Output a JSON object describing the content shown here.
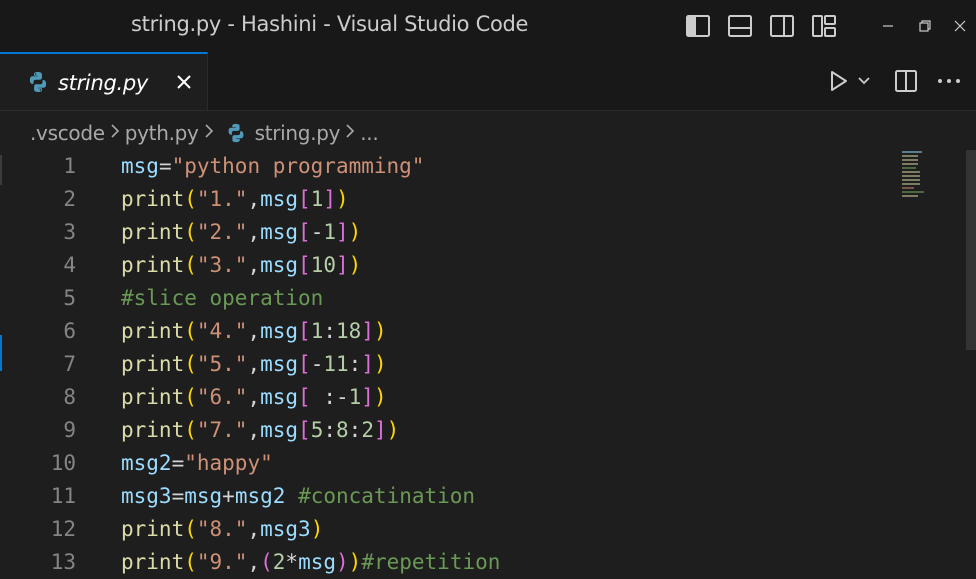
{
  "window": {
    "title": "string.py - Hashini - Visual Studio Code",
    "layout_icons": [
      "toggle-primary-sidebar-icon",
      "toggle-panel-icon",
      "toggle-secondary-sidebar-icon",
      "customize-layout-icon"
    ],
    "controls": [
      "minimize-icon",
      "restore-icon",
      "close-icon"
    ]
  },
  "tab": {
    "label": "string.py",
    "icon": "python-icon",
    "close_icon": "close-icon"
  },
  "breadcrumb": {
    "items": [
      ".vscode",
      "pyth.py",
      "string.py",
      "..."
    ]
  },
  "editor": {
    "lines": [
      {
        "n": "1",
        "tokens": [
          [
            "var",
            "msg"
          ],
          [
            "op",
            "="
          ],
          [
            "str",
            "\"python programming\""
          ]
        ]
      },
      {
        "n": "2",
        "tokens": [
          [
            "fn",
            "print"
          ],
          [
            "b1",
            "("
          ],
          [
            "str",
            "\"1.\""
          ],
          [
            "op",
            ","
          ],
          [
            "var",
            "msg"
          ],
          [
            "b2",
            "["
          ],
          [
            "num",
            "1"
          ],
          [
            "b2",
            "]"
          ],
          [
            "b1",
            ")"
          ]
        ]
      },
      {
        "n": "3",
        "tokens": [
          [
            "fn",
            "print"
          ],
          [
            "b1",
            "("
          ],
          [
            "str",
            "\"2.\""
          ],
          [
            "op",
            ","
          ],
          [
            "var",
            "msg"
          ],
          [
            "b2",
            "["
          ],
          [
            "op",
            "-"
          ],
          [
            "num",
            "1"
          ],
          [
            "b2",
            "]"
          ],
          [
            "b1",
            ")"
          ]
        ]
      },
      {
        "n": "4",
        "tokens": [
          [
            "fn",
            "print"
          ],
          [
            "b1",
            "("
          ],
          [
            "str",
            "\"3.\""
          ],
          [
            "op",
            ","
          ],
          [
            "var",
            "msg"
          ],
          [
            "b2",
            "["
          ],
          [
            "num",
            "10"
          ],
          [
            "b2",
            "]"
          ],
          [
            "b1",
            ")"
          ]
        ]
      },
      {
        "n": "5",
        "tokens": [
          [
            "com",
            "#slice operation"
          ]
        ]
      },
      {
        "n": "6",
        "tokens": [
          [
            "fn",
            "print"
          ],
          [
            "b1",
            "("
          ],
          [
            "str",
            "\"4.\""
          ],
          [
            "op",
            ","
          ],
          [
            "var",
            "msg"
          ],
          [
            "b2",
            "["
          ],
          [
            "num",
            "1"
          ],
          [
            "op",
            ":"
          ],
          [
            "num",
            "18"
          ],
          [
            "b2",
            "]"
          ],
          [
            "b1",
            ")"
          ]
        ]
      },
      {
        "n": "7",
        "tokens": [
          [
            "fn",
            "print"
          ],
          [
            "b1",
            "("
          ],
          [
            "str",
            "\"5.\""
          ],
          [
            "op",
            ","
          ],
          [
            "var",
            "msg"
          ],
          [
            "b2",
            "["
          ],
          [
            "op",
            "-"
          ],
          [
            "num",
            "11"
          ],
          [
            "op",
            ":"
          ],
          [
            "b2",
            "]"
          ],
          [
            "b1",
            ")"
          ]
        ]
      },
      {
        "n": "8",
        "tokens": [
          [
            "fn",
            "print"
          ],
          [
            "b1",
            "("
          ],
          [
            "str",
            "\"6.\""
          ],
          [
            "op",
            ","
          ],
          [
            "var",
            "msg"
          ],
          [
            "b2",
            "["
          ],
          [
            "op",
            " :-"
          ],
          [
            "num",
            "1"
          ],
          [
            "b2",
            "]"
          ],
          [
            "b1",
            ")"
          ]
        ]
      },
      {
        "n": "9",
        "tokens": [
          [
            "fn",
            "print"
          ],
          [
            "b1",
            "("
          ],
          [
            "str",
            "\"7.\""
          ],
          [
            "op",
            ","
          ],
          [
            "var",
            "msg"
          ],
          [
            "b2",
            "["
          ],
          [
            "num",
            "5"
          ],
          [
            "op",
            ":"
          ],
          [
            "num",
            "8"
          ],
          [
            "op",
            ":"
          ],
          [
            "num",
            "2"
          ],
          [
            "b2",
            "]"
          ],
          [
            "b1",
            ")"
          ]
        ]
      },
      {
        "n": "10",
        "tokens": [
          [
            "var",
            "msg2"
          ],
          [
            "op",
            "="
          ],
          [
            "str",
            "\"happy\""
          ]
        ]
      },
      {
        "n": "11",
        "tokens": [
          [
            "var",
            "msg3"
          ],
          [
            "op",
            "="
          ],
          [
            "var",
            "msg"
          ],
          [
            "op",
            "+"
          ],
          [
            "var",
            "msg2"
          ],
          [
            "op",
            " "
          ],
          [
            "com",
            "#concatination"
          ]
        ]
      },
      {
        "n": "12",
        "tokens": [
          [
            "fn",
            "print"
          ],
          [
            "b1",
            "("
          ],
          [
            "str",
            "\"8.\""
          ],
          [
            "op",
            ","
          ],
          [
            "var",
            "msg3"
          ],
          [
            "b1",
            ")"
          ]
        ]
      },
      {
        "n": "13",
        "tokens": [
          [
            "fn",
            "print"
          ],
          [
            "b1",
            "("
          ],
          [
            "str",
            "\"9.\""
          ],
          [
            "op",
            ","
          ],
          [
            "b2",
            "("
          ],
          [
            "num",
            "2"
          ],
          [
            "op",
            "*"
          ],
          [
            "var",
            "msg"
          ],
          [
            "b2",
            ")"
          ],
          [
            "b1",
            ")"
          ],
          [
            "com",
            "#repetition"
          ]
        ]
      }
    ]
  },
  "colors": {
    "accent": "#0078d4",
    "background": "#1e1e1e",
    "titlebar": "#181818"
  }
}
